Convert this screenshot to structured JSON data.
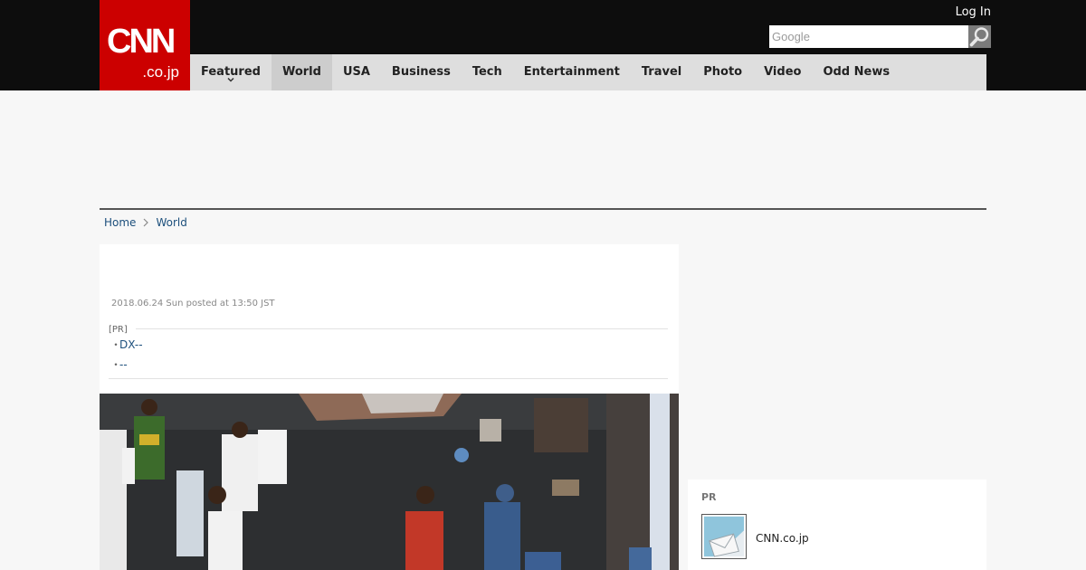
{
  "header": {
    "logo_main": "CNN",
    "logo_sub": ".co.jp",
    "login_label": "Log In",
    "search_placeholder": "Google"
  },
  "nav": {
    "items": [
      {
        "label": "Featured"
      },
      {
        "label": "World"
      },
      {
        "label": "USA"
      },
      {
        "label": "Business"
      },
      {
        "label": "Tech"
      },
      {
        "label": "Entertainment"
      },
      {
        "label": "Travel"
      },
      {
        "label": "Photo"
      },
      {
        "label": "Video"
      },
      {
        "label": "Odd News"
      }
    ],
    "active_item": "World"
  },
  "breadcrumb": {
    "items": [
      {
        "label": "Home"
      },
      {
        "label": "World"
      }
    ]
  },
  "article": {
    "date": "2018.06.24 Sun posted at 13:50 JST",
    "pr_label": "[PR]",
    "pr_links": [
      {
        "bullet": "・",
        "label": "DX--"
      },
      {
        "bullet": "・",
        "label": "--"
      }
    ],
    "photo_icon": "news-photo-crowd"
  },
  "sidebar": {
    "pr_label": "PR",
    "link_label": "CNN.co.jp",
    "thumb_icon": "mail-thumbnail-icon"
  },
  "colors": {
    "brand_red": "#cc0000",
    "header_bg": "#0d0d0d",
    "nav_bg": "#dedede",
    "nav_active_bg": "#cdcdcd",
    "link": "#1c4f7c",
    "page_bg": "#f7f7f7"
  }
}
